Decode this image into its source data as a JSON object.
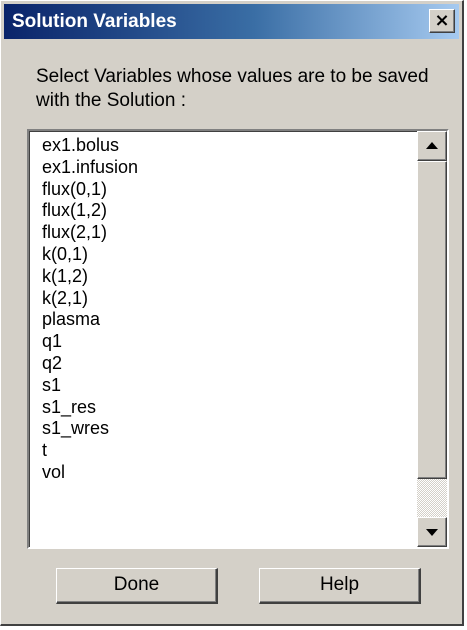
{
  "window": {
    "title": "Solution Variables",
    "close_glyph": "×",
    "close_icon": "close-icon"
  },
  "instruction": "Select Variables whose values are to be saved with the Solution :",
  "variables": [
    "ex1.bolus",
    "ex1.infusion",
    "flux(0,1)",
    "flux(1,2)",
    "flux(2,1)",
    "k(0,1)",
    "k(1,2)",
    "k(2,1)",
    "plasma",
    "q1",
    "q2",
    "s1",
    "s1_res",
    "s1_wres",
    "t",
    "vol"
  ],
  "buttons": {
    "done_label": "Done",
    "help_label": "Help"
  },
  "colors": {
    "titlebar_start": "#0a246a",
    "titlebar_end": "#a6caf0",
    "dialog_face": "#d4d0c8"
  }
}
